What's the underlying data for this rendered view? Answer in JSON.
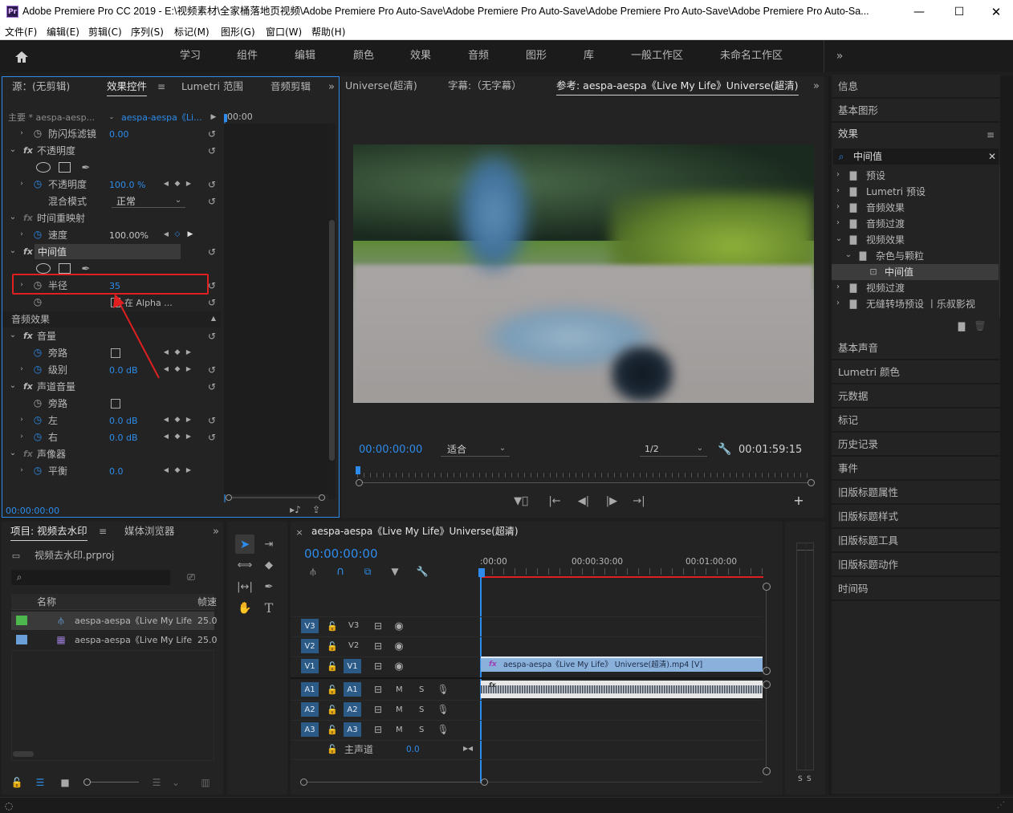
{
  "title_bar": {
    "app_icon": "Pr",
    "title": "Adobe Premiere Pro CC 2019 - E:\\视频素材\\全家桶落地页视频\\Adobe Premiere Pro Auto-Save\\Adobe Premiere Pro Auto-Save\\Adobe Premiere Pro Auto-Save\\Adobe Premiere Pro Auto-Sa...",
    "minimize": "—",
    "maximize": "☐",
    "close": "✕"
  },
  "menu": [
    "文件(F)",
    "编辑(E)",
    "剪辑(C)",
    "序列(S)",
    "标记(M)",
    "图形(G)",
    "窗口(W)",
    "帮助(H)"
  ],
  "workspaces": [
    "学习",
    "组件",
    "编辑",
    "颜色",
    "效果",
    "音频",
    "图形",
    "库",
    "一般工作区",
    "未命名工作区"
  ],
  "effect_controls": {
    "tabs": [
      "源：(无剪辑)",
      "效果控件",
      "Lumetri 范围",
      "音频剪辑"
    ],
    "master": "主要 * aespa-aesp...",
    "clip": "aespa-aespa《Li...",
    "time_ruler": "00:00",
    "rows": {
      "flicker": {
        "name": "防闪烁滤镜",
        "value": "0.00"
      },
      "opacity": {
        "name": "不透明度"
      },
      "opacity_val": {
        "name": "不透明度",
        "value": "100.0 %"
      },
      "blend": {
        "name": "混合模式",
        "value": "正常"
      },
      "timeremap": {
        "name": "时间重映射"
      },
      "speed": {
        "name": "速度",
        "value": "100.00%"
      },
      "median": {
        "name": "中间值"
      },
      "radius": {
        "name": "半径",
        "value": "35"
      },
      "alpha": {
        "value": "在 Alpha ..."
      },
      "audio_effects": {
        "name": "音频效果"
      },
      "volume": {
        "name": "音量"
      },
      "bypass1": {
        "name": "旁路"
      },
      "level": {
        "name": "级别",
        "value": "0.0 dB"
      },
      "channel": {
        "name": "声道音量"
      },
      "bypass2": {
        "name": "旁路"
      },
      "left": {
        "name": "左",
        "value": "0.0 dB"
      },
      "right": {
        "name": "右",
        "value": "0.0 dB"
      },
      "panner": {
        "name": "声像器"
      },
      "balance": {
        "name": "平衡",
        "value": "0.0"
      }
    },
    "timecode": "00:00:00:00"
  },
  "program": {
    "tabs": [
      "Universe(超清)",
      "字幕:（无字幕）",
      "参考: aespa-aespa《Live My Life》Universe(超清)"
    ],
    "timecode": "00:00:00:00",
    "fit": "适合",
    "resolution": "1/2",
    "duration": "00:01:59:15"
  },
  "project": {
    "tabs": [
      "项目: 视频去水印",
      "媒体浏览器"
    ],
    "file": "视频去水印.prproj",
    "columns": {
      "name": "名称",
      "rate": "帧速"
    },
    "items": [
      {
        "name": "aespa-aespa《Live My Life",
        "rate": "25.0",
        "color": "#4db84d"
      },
      {
        "name": "aespa-aespa《Live My Life",
        "rate": "25.0",
        "color": "#6a9fd8"
      }
    ]
  },
  "timeline": {
    "tab": "aespa-aespa《Live My Life》Universe(超清)",
    "timecode": "00:00:00:00",
    "ruler": [
      ":00:00",
      "00:00:30:00",
      "00:01:00:00"
    ],
    "video_tracks": [
      {
        "src": "V3",
        "dst": "V3"
      },
      {
        "src": "V2",
        "dst": "V2"
      },
      {
        "src": "V1",
        "dst": "V1"
      }
    ],
    "audio_tracks": [
      {
        "src": "A1",
        "dst": "A1"
      },
      {
        "src": "A2",
        "dst": "A2"
      },
      {
        "src": "A3",
        "dst": "A3"
      }
    ],
    "clip_label": "aespa-aespa《Live My Life》 Universe(超清).mp4 [V]",
    "master_label": "主声道",
    "master_value": "0.0",
    "mute": "M",
    "solo": "S",
    "fx": "fx"
  },
  "meter": {
    "labels": [
      "S",
      "S"
    ]
  },
  "right_panel": {
    "top_items": [
      "信息",
      "基本图形"
    ],
    "effects_title": "效果",
    "search": "中间值",
    "tree": [
      {
        "label": "预设",
        "depth": 0,
        "open": false
      },
      {
        "label": "Lumetri 预设",
        "depth": 0,
        "open": false
      },
      {
        "label": "音频效果",
        "depth": 0,
        "open": false
      },
      {
        "label": "音频过渡",
        "depth": 0,
        "open": false
      },
      {
        "label": "视频效果",
        "depth": 0,
        "open": true
      },
      {
        "label": "杂色与颗粒",
        "depth": 1,
        "open": true
      },
      {
        "label": "中间值",
        "depth": 2,
        "open": false
      },
      {
        "label": "视频过渡",
        "depth": 0,
        "open": false
      },
      {
        "label": "无缝转场预设 丨乐叔影视",
        "depth": 0,
        "open": false
      }
    ],
    "bottom_items": [
      "基本声音",
      "Lumetri 颜色",
      "元数据",
      "标记",
      "历史记录",
      "事件",
      "旧版标题属性",
      "旧版标题样式",
      "旧版标题工具",
      "旧版标题动作",
      "时间码"
    ]
  },
  "colors": {
    "accent": "#2d8ceb",
    "highlight": "#e02020",
    "clip_video": "#8ab0dc",
    "track_btn": "#2b5a86"
  }
}
